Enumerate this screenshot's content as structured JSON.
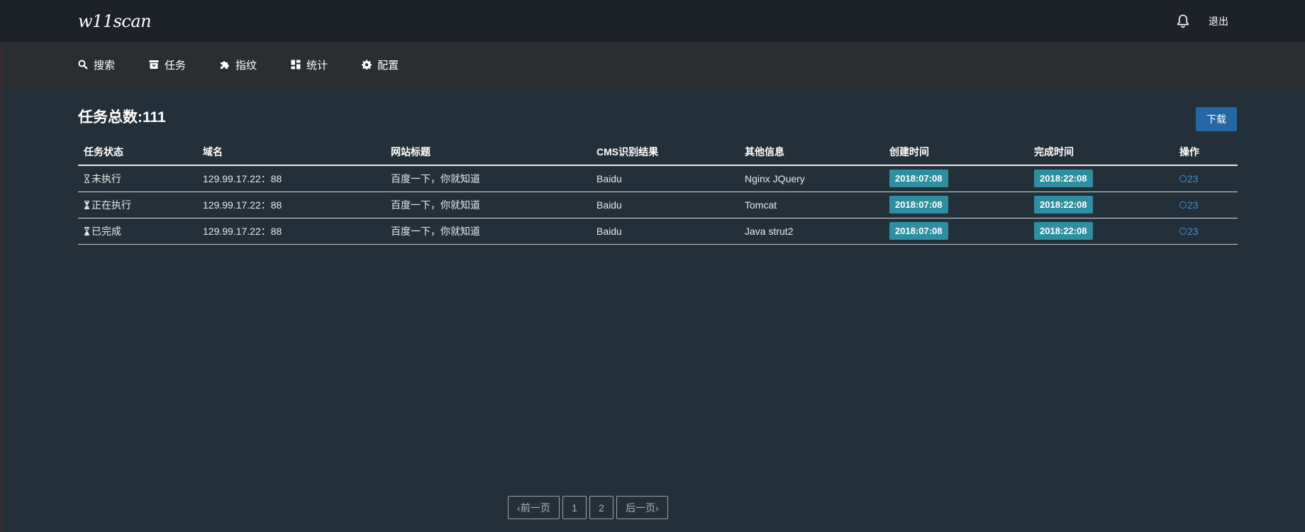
{
  "app": {
    "logo": "w11scan"
  },
  "topbar": {
    "logout_label": "退出",
    "bell_icon": "bell-icon"
  },
  "nav": {
    "items": [
      {
        "label": "搜索",
        "icon": "search-icon"
      },
      {
        "label": "任务",
        "icon": "archive-icon"
      },
      {
        "label": "指纹",
        "icon": "puzzle-icon"
      },
      {
        "label": "统计",
        "icon": "dashboard-icon"
      },
      {
        "label": "配置",
        "icon": "gear-icon"
      }
    ]
  },
  "main": {
    "title": "任务总数:111",
    "download_label": "下载"
  },
  "table": {
    "headers": [
      "任务状态",
      "域名",
      "网站标题",
      "CMS识别结果",
      "其他信息",
      "创建时间",
      "完成时间",
      "操作"
    ],
    "rows": [
      {
        "status": "未执行",
        "domain": "129.99.17.22：88",
        "title": "百度一下，你就知道",
        "cms": "Baidu",
        "info": "Nginx JQuery",
        "created": "2018:07:08",
        "done": "2018:22:08",
        "op": "23"
      },
      {
        "status": "正在执行",
        "domain": "129.99.17.22：88",
        "title": "百度一下，你就知道",
        "cms": "Baidu",
        "info": "Tomcat",
        "created": "2018:07:08",
        "done": "2018:22:08",
        "op": "23"
      },
      {
        "status": "已完成",
        "domain": "129.99.17.22：88",
        "title": "百度一下，你就知道",
        "cms": "Baidu",
        "info": "Java strut2",
        "created": "2018:07:08",
        "done": "2018:22:08",
        "op": "23"
      }
    ]
  },
  "pagination": {
    "prev_label": "‹前一页",
    "pages": [
      "1",
      "2"
    ],
    "next_label": "后一页›"
  },
  "colors": {
    "accent": "#2567a3",
    "badge": "#2e8fa0",
    "link": "#3d8fd6"
  }
}
